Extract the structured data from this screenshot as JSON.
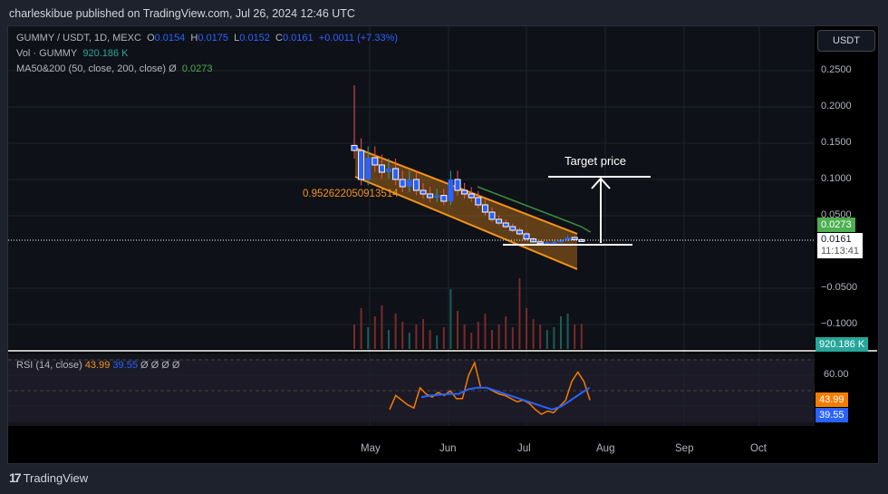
{
  "published": "charleskibue published on TradingView.com, Jul 26, 2024 12:46 UTC",
  "legend": {
    "symbol": "GUMMY / USDT, 1D, MEXC",
    "o_label": "O",
    "o": "0.0154",
    "h_label": "H",
    "h": "0.0175",
    "l_label": "L",
    "l": "0.0152",
    "c_label": "C",
    "c": "0.0161",
    "change": "+0.0011 (+7.33%)",
    "vol_label": "Vol · GUMMY",
    "vol": "920.186 K",
    "ma_label": "MA50&200 (50, close, 200, close)  Ø",
    "ma": "0.0273",
    "rsi_label": "RSI (14, close)",
    "rsi": "43.99",
    "rsi_ma": "39.55",
    "rsi_rest": "Ø  Ø  Ø  Ø"
  },
  "currency_button": "USDT",
  "price_axis": [
    "0.2500",
    "0.2000",
    "0.1500",
    "0.1000",
    "0.0500",
    "−0.0500",
    "−0.1000"
  ],
  "tags": {
    "ma": "0.0273",
    "last": "0.0161",
    "countdown": "11:13:41",
    "volume": "920.186 K",
    "rsi_axis": "60.00",
    "rsi": "43.99",
    "rsi_ma": "39.55"
  },
  "time_axis": [
    "May",
    "Jun",
    "Jul",
    "Aug",
    "Sep",
    "Oct"
  ],
  "annotations": {
    "fib_text": "0.952622050913514",
    "target": "Target price"
  },
  "logo": "TradingView",
  "colors": {
    "up": "#26a69a",
    "down": "#ef5350",
    "candle": "#2962ff",
    "channel": "#f7931a",
    "ma": "#388e3c",
    "rsi": "#f57c00",
    "rsi_ma": "#2962ff"
  },
  "chart_data": {
    "type": "line",
    "title": "GUMMY / USDT, 1D, MEXC",
    "x_start": "2024-04-26",
    "step_days": 2.7,
    "close": [
      0.14,
      0.1,
      0.13,
      0.12,
      0.11,
      0.115,
      0.1,
      0.09,
      0.1,
      0.085,
      0.08,
      0.075,
      0.078,
      0.07,
      0.1,
      0.085,
      0.08,
      0.075,
      0.065,
      0.055,
      0.045,
      0.04,
      0.035,
      0.03,
      0.025,
      0.018,
      0.014,
      0.013,
      0.013,
      0.014,
      0.016,
      0.02,
      0.017,
      0.0161
    ],
    "high_spike": 0.23,
    "volume_k": [
      900,
      1500,
      800,
      1200,
      1600,
      700,
      1300,
      1000,
      600,
      900,
      1100,
      700,
      500,
      800,
      2200,
      1400,
      900,
      600,
      1000,
      1300,
      700,
      900,
      1200,
      800,
      2600,
      1500,
      1100,
      900,
      700,
      800,
      1200,
      1300,
      900,
      920
    ],
    "ma50": [
      0.09,
      0.085,
      0.08,
      0.075,
      0.07,
      0.065,
      0.06,
      0.055,
      0.05,
      0.045,
      0.04,
      0.035,
      0.0273
    ],
    "rsi": [
      38,
      47,
      44,
      41,
      39,
      52,
      48,
      46,
      49,
      47,
      50,
      45,
      45,
      60,
      68,
      52,
      52,
      50,
      48,
      47,
      45,
      43,
      44,
      42,
      38,
      35,
      37,
      36,
      40,
      44,
      56,
      62,
      56,
      44
    ],
    "rsi_ma": [
      46,
      47,
      47.5,
      48,
      48,
      51,
      52,
      52,
      50,
      48,
      46,
      44,
      42,
      40,
      38,
      40,
      44,
      48,
      52
    ],
    "yaxis": {
      "min": -0.12,
      "max": 0.27
    },
    "rsi_levels": [
      30,
      50,
      70
    ]
  }
}
